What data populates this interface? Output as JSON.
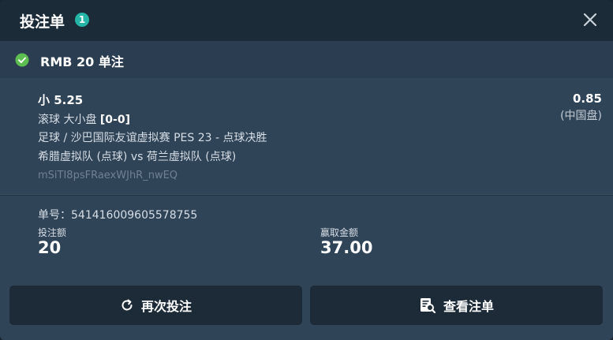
{
  "header": {
    "title": "投注单",
    "count": "1"
  },
  "summary": {
    "label": "RMB 20 单注"
  },
  "bet": {
    "selection": "小 5.25",
    "market": "滚球 大小盘",
    "score": "[0-0]",
    "league": "足球 / 沙巴国际友谊虚拟赛 PES 23 - 点球决胜",
    "teams": "希腊虚拟队 (点球) vs 荷兰虚拟队 (点球)",
    "reference": "mSiTI8psFRaexWJhR_nwEQ",
    "odds": "0.85",
    "odds_type": "(中国盘)"
  },
  "info": {
    "ticket_label": "单号：",
    "ticket_number": "541416009605578755",
    "stake_label": "投注额",
    "stake_value": "20",
    "win_label": "赢取金额",
    "win_value": "37.00"
  },
  "actions": {
    "rebet_label": "再次投注",
    "view_label": "查看注单"
  },
  "colors": {
    "badge": "#24b5a7",
    "success": "#5cbd50",
    "button_bg": "#1d2b39"
  }
}
